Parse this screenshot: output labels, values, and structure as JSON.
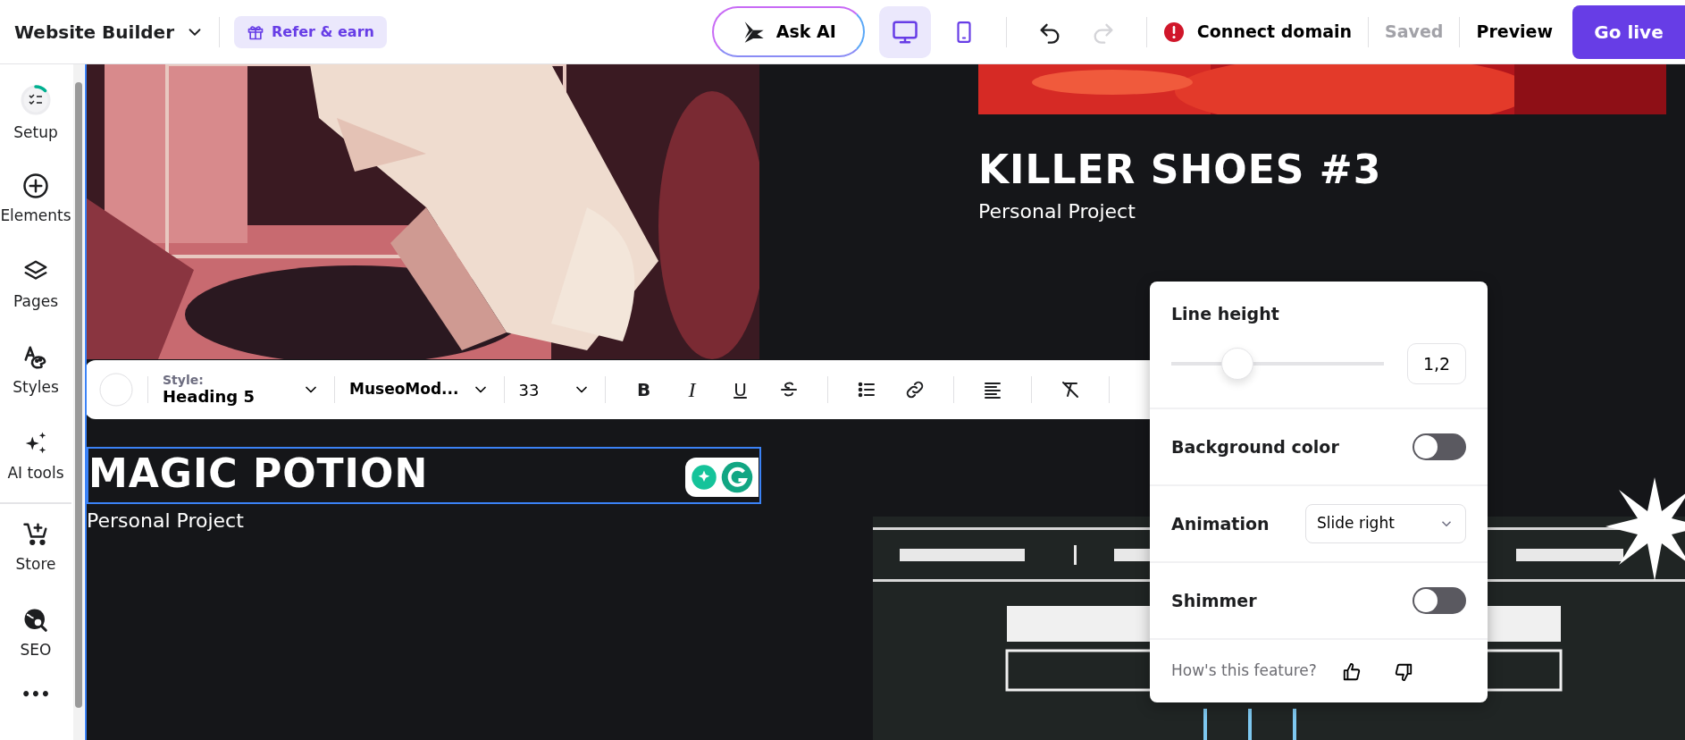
{
  "header": {
    "title": "Website Builder",
    "refer": "Refer & earn",
    "ask_ai": "Ask AI",
    "devices": [
      {
        "kind": "desktop",
        "selected": true
      },
      {
        "kind": "mobile",
        "selected": false
      }
    ],
    "history": [
      {
        "kind": "undo",
        "disabled": false
      },
      {
        "kind": "redo",
        "disabled": true
      }
    ],
    "connect_domain": "Connect domain",
    "saved": {
      "label": "Saved",
      "disabled": true
    },
    "preview": "Preview",
    "go_live": "Go live"
  },
  "sidebar": {
    "items": [
      {
        "kind": "setup",
        "label": "Setup"
      },
      {
        "kind": "elements",
        "label": "Elements"
      },
      {
        "kind": "pages",
        "label": "Pages"
      },
      {
        "kind": "styles",
        "label": "Styles"
      },
      {
        "kind": "ai",
        "label": "AI tools"
      },
      {
        "kind": "store",
        "label": "Store"
      },
      {
        "kind": "seo",
        "label": "SEO"
      },
      {
        "kind": "more",
        "label": "•••"
      }
    ]
  },
  "canvas": {
    "projects": [
      {
        "title": "KILLER SHOES #3",
        "subtitle": "Personal Project",
        "selected": false
      },
      {
        "title": "MAGIC POTION",
        "subtitle": "Personal Project",
        "selected": true
      }
    ]
  },
  "toolbar": {
    "style_label": "Style:",
    "style": "Heading 5",
    "font": "MuseoMod...",
    "size": "33",
    "buttons": [
      {
        "kind": "bold",
        "glyph": "B"
      },
      {
        "kind": "italic",
        "glyph": "I"
      },
      {
        "kind": "underline",
        "glyph": "U"
      },
      {
        "kind": "strike"
      },
      {
        "kind": "list"
      },
      {
        "kind": "link"
      },
      {
        "kind": "align"
      },
      {
        "kind": "clear"
      }
    ]
  },
  "popup": {
    "line_height": {
      "label": "Line height",
      "level": 0.31,
      "value": "1,2"
    },
    "rows": [
      {
        "kind": "toggle",
        "label": "Background color",
        "on": false
      },
      {
        "kind": "select",
        "label": "Animation",
        "value": "Slide right"
      },
      {
        "kind": "toggle",
        "label": "Shimmer",
        "on": false
      }
    ],
    "feedback": "How's this feature?"
  }
}
